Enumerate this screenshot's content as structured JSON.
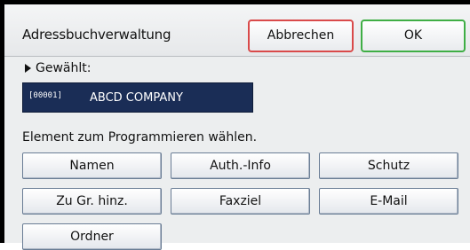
{
  "header": {
    "title": "Adressbuchverwaltung",
    "cancel_label": "Abbrechen",
    "ok_label": "OK"
  },
  "selection": {
    "label": "Gewählt:",
    "entry_number": "[00001]",
    "entry_name": "ABCD COMPANY"
  },
  "instruction": "Element zum Programmieren wählen.",
  "items": [
    {
      "label": "Namen"
    },
    {
      "label": "Auth.-Info"
    },
    {
      "label": "Schutz"
    },
    {
      "label": "Zu Gr. hinz."
    },
    {
      "label": "Faxziel"
    },
    {
      "label": "E-Mail"
    },
    {
      "label": "Ordner"
    }
  ],
  "colors": {
    "cancel_border": "#d94a4a",
    "ok_border": "#3fae45",
    "entry_background": "#1a2d56"
  }
}
